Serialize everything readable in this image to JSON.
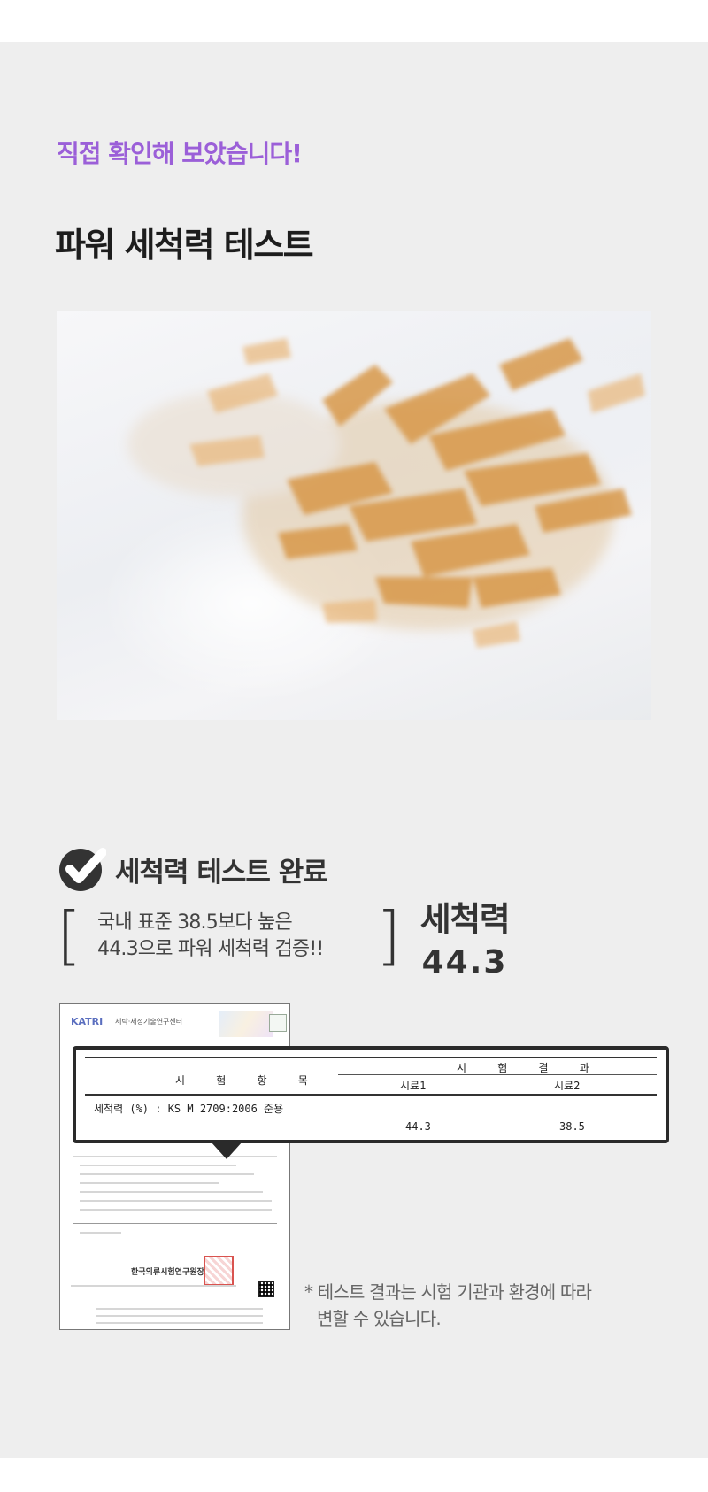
{
  "header": {
    "eyebrow": "직접 확인해 보았습니다!",
    "headline": "파워 세척력 테스트"
  },
  "result": {
    "title": "세척력 테스트 완료",
    "bracket_open": "[",
    "bracket_close": "]",
    "line1": "국내 표준 38.5보다 높은",
    "line2": "44.3으로 파워 세척력 검증!!",
    "power_label": "세척력",
    "power_value": "44.3"
  },
  "certificate": {
    "logo": "KATRI",
    "logo_sub": "세탁·세정기술연구센터",
    "org": "한국의류시험연구원장",
    "table": {
      "item_header": "시 험 항 목",
      "result_header": "시 험 결 과",
      "sample1": "시료1",
      "sample2": "시료2",
      "row_label": "세척력 (%) : KS M 2709:2006 준용",
      "value1": "44.3",
      "value2": "38.5"
    }
  },
  "disclaimer": {
    "line1": "* 테스트 결과는 시험 기관과 환경에 따라",
    "line2": "변할 수 있습니다."
  },
  "colors": {
    "accent": "#9b5fd8",
    "background": "#eeeeee",
    "text": "#222222",
    "stain": "#d89a4e"
  },
  "icons": {
    "check": "check-circle-icon"
  }
}
